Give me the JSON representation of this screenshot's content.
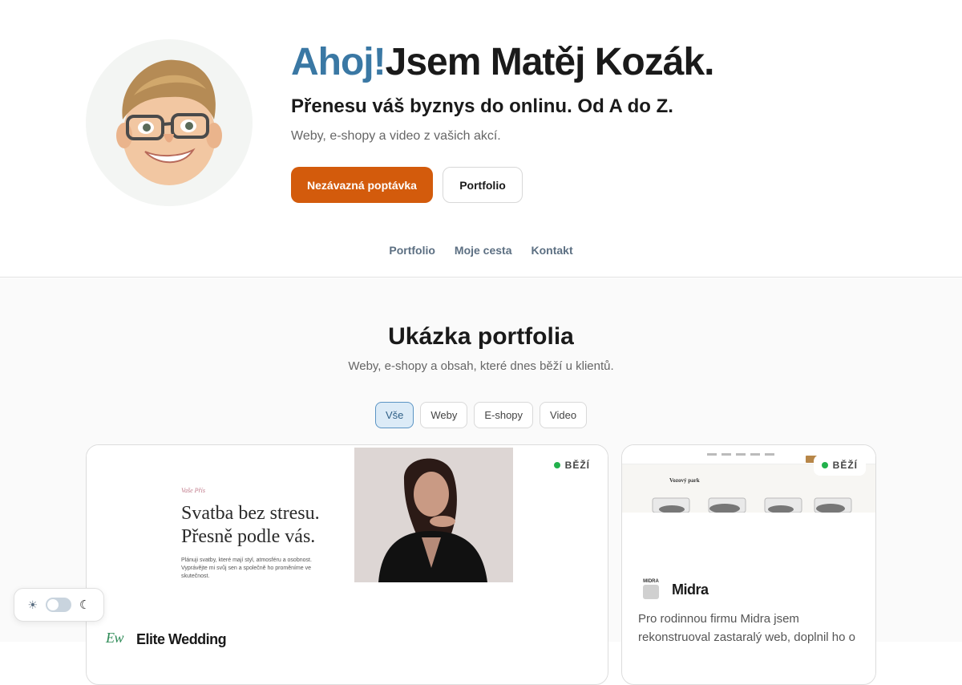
{
  "hero": {
    "greeting": "Ahoj!",
    "name": "Jsem Matěj Kozák.",
    "headline": "Přenesu váš byznys do onlinu. Od A do Z.",
    "lead": "Weby, e-shopy a video z vašich akcí.",
    "cta_primary": "Nezávazná poptávka",
    "cta_secondary": "Portfolio"
  },
  "nav": {
    "items": [
      "Portfolio",
      "Moje cesta",
      "Kontakt"
    ]
  },
  "portfolio": {
    "title": "Ukázka portfolia",
    "subtitle": "Weby, e-shopy a obsah, které dnes běží u klientů.",
    "filters": [
      "Vše",
      "Weby",
      "E-shopy",
      "Video"
    ],
    "active_filter": "Vše",
    "cards": [
      {
        "status": "BĚŽÍ",
        "preview": {
          "kicker": "Vaše Přís",
          "heading_line1": "Svatba bez stresu.",
          "heading_line2": "Přesně podle vás.",
          "body": "Plánuji svatby, které mají styl, atmosféru a osobnost. Vyprávějte mi svůj sen a společně ho proměníme ve skutečnost."
        },
        "logo_mark": "Ew",
        "name": "Elite Wedding"
      },
      {
        "status": "BĚŽÍ",
        "preview": {
          "heading": "Vozový park"
        },
        "logo_mark": "MIDRA",
        "name": "Midra",
        "description": "Pro rodinnou firmu Midra jsem rekonstruoval zastaralý web, doplnil ho o"
      }
    ]
  },
  "theme": {
    "light_icon": "sun-icon",
    "dark_icon": "moon-icon"
  },
  "colors": {
    "accent": "#3a78a4",
    "primary_button": "#d35b0c",
    "status_dot": "#22b14c"
  }
}
